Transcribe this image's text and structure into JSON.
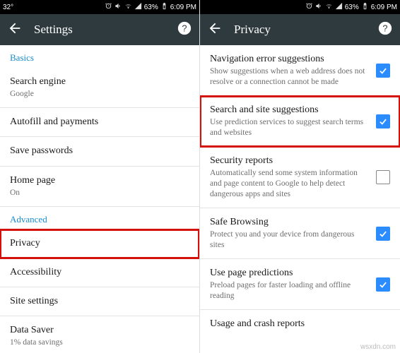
{
  "status": {
    "temp": "32°",
    "battery": "63%",
    "time": "6:09 PM"
  },
  "left": {
    "title": "Settings",
    "sections": {
      "basics": "Basics",
      "advanced": "Advanced"
    },
    "rows": {
      "search_engine": {
        "label": "Search engine",
        "sub": "Google"
      },
      "autofill": {
        "label": "Autofill and payments"
      },
      "save_passwords": {
        "label": "Save passwords"
      },
      "home_page": {
        "label": "Home page",
        "sub": "On"
      },
      "privacy": {
        "label": "Privacy"
      },
      "accessibility": {
        "label": "Accessibility"
      },
      "site_settings": {
        "label": "Site settings"
      },
      "data_saver": {
        "label": "Data Saver",
        "sub": "1% data savings"
      }
    }
  },
  "right": {
    "title": "Privacy",
    "rows": {
      "nav_err": {
        "label": "Navigation error suggestions",
        "sub": "Show suggestions when a web address does not resolve or a connection cannot be made",
        "checked": true
      },
      "search_site": {
        "label": "Search and site suggestions",
        "sub": "Use prediction services to suggest search terms and websites",
        "checked": true
      },
      "security_reports": {
        "label": "Security reports",
        "sub": "Automatically send some system information and page content to Google to help detect dangerous apps and sites",
        "checked": false
      },
      "safe_browsing": {
        "label": "Safe Browsing",
        "sub": "Protect you and your device from dangerous sites",
        "checked": true
      },
      "page_predictions": {
        "label": "Use page predictions",
        "sub": "Preload pages for faster loading and offline reading",
        "checked": true
      },
      "usage_crash": {
        "label": "Usage and crash reports"
      }
    }
  },
  "watermark": "wsxdn.com"
}
